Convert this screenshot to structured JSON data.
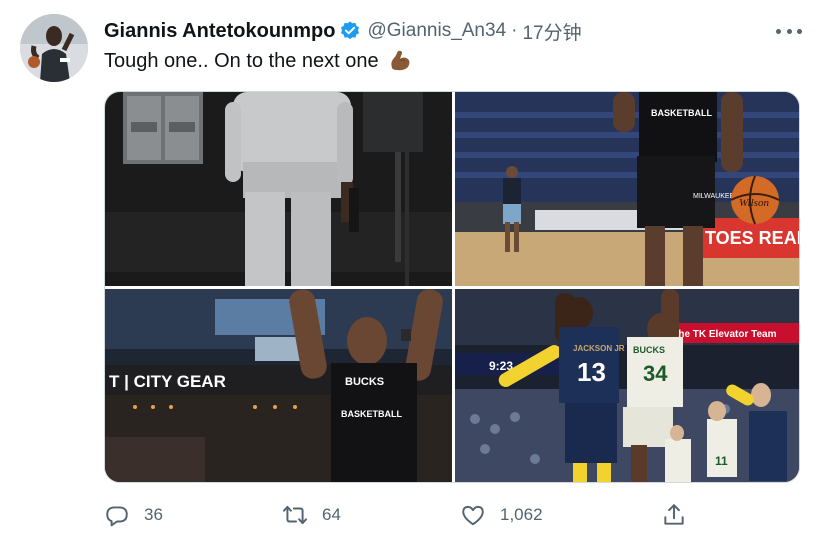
{
  "user": {
    "display_name": "Giannis Antetokounmpo",
    "handle": "@Giannis_An34",
    "separator": "·",
    "time": "17分钟",
    "verified": true,
    "avatar_icon": "profile-photo"
  },
  "tweet": {
    "text": "Tough one.. On to the next one",
    "emoji": "flexed-biceps-medium-dark-skin"
  },
  "media": {
    "count": 4,
    "images": [
      {
        "subject": "player walking in arena tunnel"
      },
      {
        "subject": "player dribbling basketball on court"
      },
      {
        "subject": "player warming up, arms raised, CITY GEAR sign"
      },
      {
        "subject": "game action, jersey 13 vs jersey 34"
      }
    ],
    "visible_text": {
      "city_gear": "T | CITY GEAR",
      "bucks": "BUCKS",
      "jersey_13": "13",
      "jersey_34": "34",
      "jackson_jr": "JACKSON JR",
      "elevator_banner": "the TK Elevator Team",
      "scoreboard_time": "9:23",
      "bucks_basketball": "BASKETBALL",
      "wilson": "Wilson",
      "jersey_11": "11"
    }
  },
  "actions": {
    "reply_count": "36",
    "retweet_count": "64",
    "like_count": "1,062",
    "share_icon": "share-icon"
  },
  "colors": {
    "text_primary": "#0f1419",
    "text_secondary": "#536471",
    "verified_blue": "#1d9bf0",
    "border": "#cfd9de"
  }
}
